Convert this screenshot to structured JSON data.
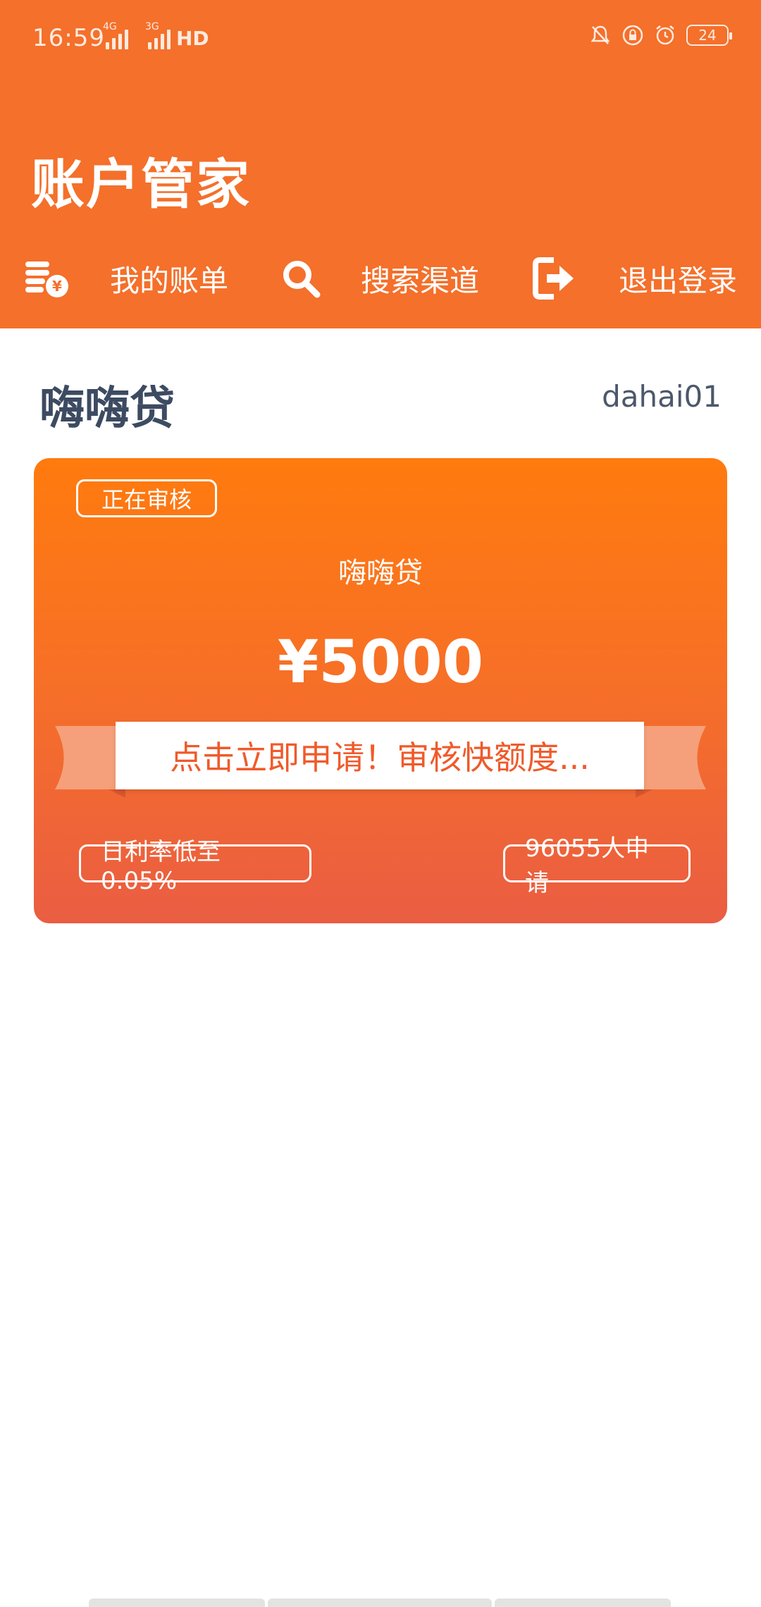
{
  "status_bar": {
    "time": "16:59",
    "network1": "4G",
    "network2": "3G",
    "hd": "HD",
    "battery": "24"
  },
  "header": {
    "title": "账户管家",
    "nav": [
      {
        "label": "我的账单",
        "icon": "coins-yen-icon"
      },
      {
        "label": "搜索渠道",
        "icon": "search-icon"
      },
      {
        "label": "退出登录",
        "icon": "logout-icon"
      }
    ]
  },
  "section": {
    "title": "嗨嗨贷",
    "username": "dahai01"
  },
  "loan_card": {
    "status": "正在审核",
    "name": "嗨嗨贷",
    "amount": "¥5000",
    "cta": "点击立即申请！审核快额度...",
    "rate_tag": "日利率低至0.05%",
    "applicants_tag": "96055人申请"
  },
  "colors": {
    "brand_orange": "#f4702b",
    "card_top": "#ff7b0e",
    "card_bottom": "#ea5d43",
    "title_text": "#3d4b62"
  }
}
